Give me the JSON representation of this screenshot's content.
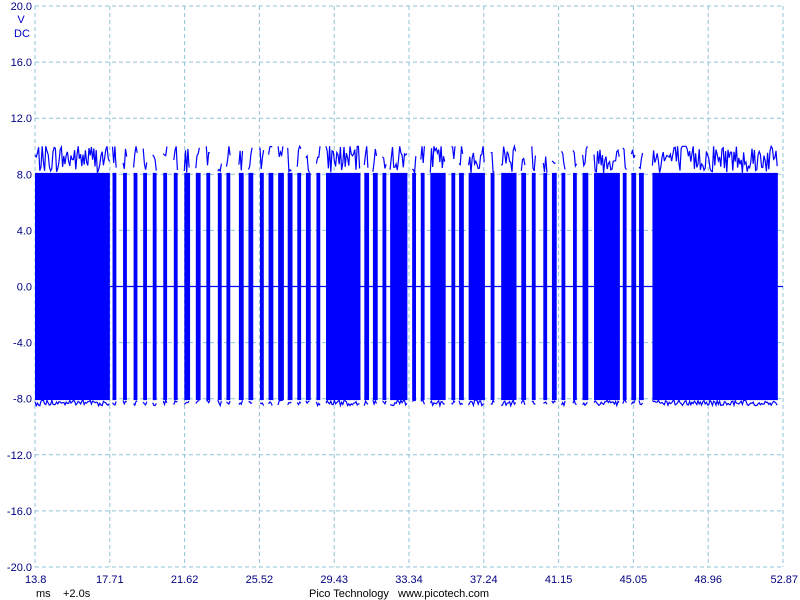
{
  "chart_data": {
    "type": "line",
    "title": "",
    "y_unit": "V",
    "y_coupling": "DC",
    "ylim": [
      -20.0,
      20.0
    ],
    "yticks": [
      "20.0",
      "16.0",
      "12.0",
      "8.0",
      "4.0",
      "0.0",
      "-4.0",
      "-8.0",
      "-12.0",
      "-16.0",
      "-20.0"
    ],
    "xlim": [
      13.8,
      52.87
    ],
    "xticks": [
      "13.8",
      "17.71",
      "21.62",
      "25.52",
      "29.43",
      "33.34",
      "37.24",
      "41.15",
      "45.05",
      "48.96",
      "52.87"
    ],
    "x_unit": "ms",
    "x_offset": "+2.0s",
    "grid": true,
    "series": [
      {
        "color": "#0000ff",
        "description": "bursts of a fast oscillating signal, swinging roughly -10 V to +10 V",
        "envelope_max_v": 10.0,
        "envelope_min_v": -10.0,
        "burst_intervals_ms": [
          [
            13.8,
            17.71
          ],
          [
            17.85,
            18.05
          ],
          [
            18.4,
            18.6
          ],
          [
            18.95,
            19.15
          ],
          [
            19.45,
            19.65
          ],
          [
            19.95,
            20.15
          ],
          [
            20.5,
            20.7
          ],
          [
            21.05,
            21.25
          ],
          [
            21.6,
            21.9
          ],
          [
            22.2,
            22.45
          ],
          [
            22.75,
            22.95
          ],
          [
            23.35,
            23.55
          ],
          [
            23.8,
            24.0
          ],
          [
            24.45,
            24.7
          ],
          [
            24.95,
            25.2
          ],
          [
            25.55,
            25.75
          ],
          [
            26.0,
            26.25
          ],
          [
            26.5,
            26.8
          ],
          [
            27.0,
            27.25
          ],
          [
            27.5,
            27.7
          ],
          [
            27.95,
            28.2
          ],
          [
            28.5,
            28.7
          ],
          [
            29.0,
            30.8
          ],
          [
            31.0,
            31.25
          ],
          [
            31.45,
            31.7
          ],
          [
            31.95,
            32.15
          ],
          [
            32.35,
            33.25
          ],
          [
            33.5,
            33.7
          ],
          [
            33.95,
            34.15
          ],
          [
            34.45,
            35.25
          ],
          [
            35.55,
            35.75
          ],
          [
            35.95,
            36.2
          ],
          [
            36.45,
            37.3
          ],
          [
            37.6,
            37.8
          ],
          [
            38.15,
            38.95
          ],
          [
            39.2,
            39.45
          ],
          [
            39.75,
            39.95
          ],
          [
            40.35,
            40.55
          ],
          [
            40.8,
            41.05
          ],
          [
            41.3,
            41.5
          ],
          [
            41.9,
            42.1
          ],
          [
            42.4,
            42.7
          ],
          [
            43.0,
            44.35
          ],
          [
            44.5,
            44.7
          ],
          [
            44.95,
            45.2
          ],
          [
            45.35,
            45.6
          ],
          [
            46.05,
            52.6
          ]
        ]
      }
    ]
  },
  "footer": {
    "x_unit": "ms",
    "x_offset": "+2.0s",
    "brand": "Pico Technology",
    "website": "www.picotech.com"
  }
}
